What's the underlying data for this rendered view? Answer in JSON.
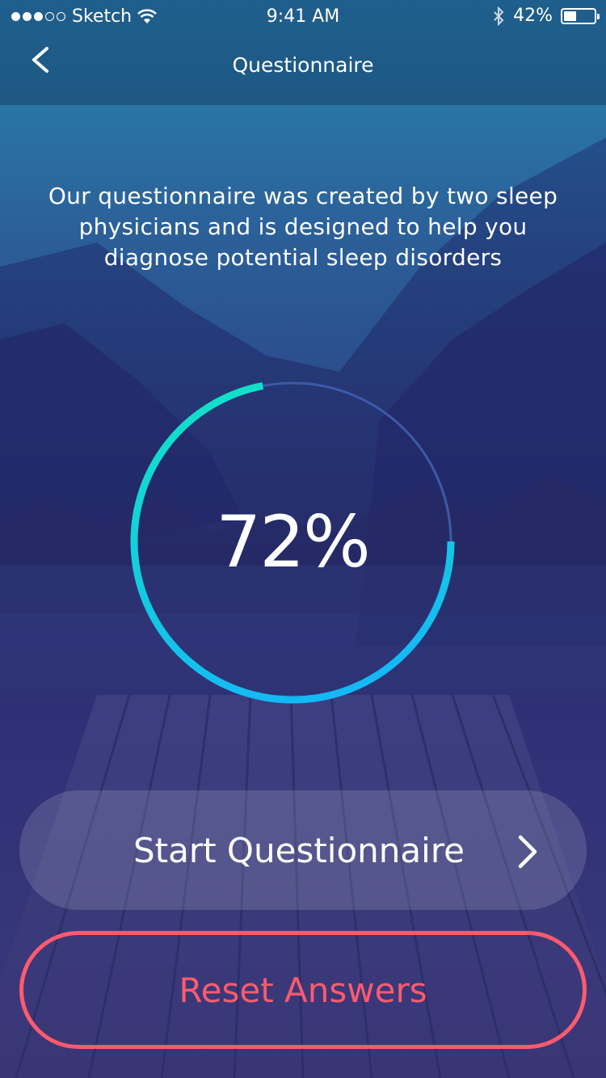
{
  "status_bar": {
    "carrier": "Sketch",
    "time": "9:41 AM",
    "battery": "42%",
    "battery_level": 0.42,
    "signal_bars_filled": 3,
    "signal_bars_total": 5
  },
  "nav": {
    "title": "Questionnaire",
    "back_icon": "chevron-left-icon"
  },
  "intro": {
    "text": "Our questionnaire was created by two sleep physicians and is designed to help you diagnose potential sleep disorders"
  },
  "progress": {
    "label": "72%",
    "value": 0.72,
    "colors": {
      "track": "#3d5aa6",
      "start": "#12e0c8",
      "end": "#14b8f5"
    }
  },
  "buttons": {
    "start": {
      "label": "Start Questionnaire",
      "icon": "chevron-right-icon"
    },
    "reset": {
      "label": "Reset Answers",
      "color": "#ff5a6e"
    }
  }
}
